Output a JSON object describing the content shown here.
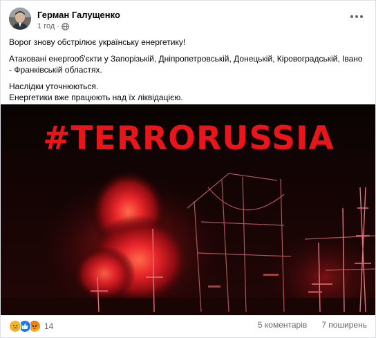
{
  "post": {
    "author": "Герман Галущенко",
    "time": "1 год",
    "time_separator": "·",
    "icons": {
      "avatar": "avatar-photo",
      "privacy": "globe-icon",
      "options": "more-options-icon"
    },
    "paragraphs": [
      "Ворог знову обстрілює українську енергетику!",
      "Атаковані енергооб'єкти у Запорізькій, Дніпропетровській, Донецькій, Кіровоградській, Івано - Франківській областях.",
      "Наслідки уточнюються.",
      "Енергетики вже працюють над їх ліквідацією."
    ],
    "image": {
      "hashtag": "#TERRORUSSIA",
      "hashtag_color": "#e8161b",
      "scene": "substation-fire"
    },
    "reactions": {
      "types": [
        "sad",
        "like",
        "angry"
      ],
      "count": "14",
      "comments": "5 коментарів",
      "shares": "7 поширень"
    }
  },
  "colors": {
    "accent": "#1877f2",
    "secondary_text": "#65676b",
    "text": "#050505"
  }
}
